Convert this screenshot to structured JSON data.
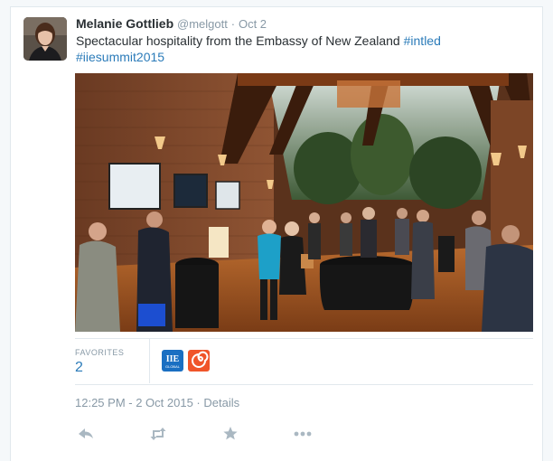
{
  "tweet": {
    "author_name": "Melanie Gottlieb",
    "author_handle": "@melgott",
    "separator": "·",
    "date": "Oct 2",
    "text_main": "Spectacular hospitality from the Embassy of New Zealand ",
    "hashtag_1": "#intled",
    "hashtag_2": "#iiesummit2015",
    "timestamp": "12:25 PM - 2 Oct 2015",
    "details_separator": "·",
    "details_label": "Details"
  },
  "stats": {
    "favorites_label": "FAVORITES",
    "favorites_count": "2",
    "favoriters": [
      {
        "icon": "iie-global-logo-icon",
        "label_top": "IIE",
        "label_bottom": "GLOBAL",
        "color": "#1a6fc2"
      },
      {
        "icon": "spiral-logo-icon",
        "color": "#f0552a"
      }
    ]
  },
  "actions": [
    {
      "name": "reply-icon"
    },
    {
      "name": "retweet-icon"
    },
    {
      "name": "favorite-icon"
    },
    {
      "name": "more-icon"
    }
  ],
  "colors": {
    "link": "#2b7bb9",
    "muted": "#8899a6",
    "text": "#292f33",
    "border": "#e1e8ed"
  }
}
